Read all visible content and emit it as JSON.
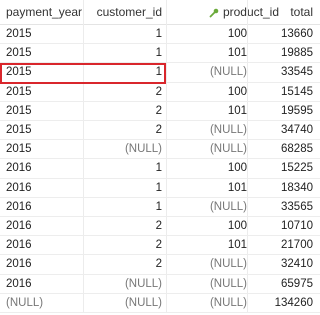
{
  "columns": {
    "payment_year": "payment_year",
    "customer_id": "customer_id",
    "product_id": "product_id",
    "total": "total"
  },
  "key_icon_color": "#6aaa3a",
  "selection_color": "#d9262c",
  "rows": [
    [
      "2015",
      "1",
      "100",
      "13660"
    ],
    [
      "2015",
      "1",
      "101",
      "19885"
    ],
    [
      "2015",
      "1",
      "(NULL)",
      "33545"
    ],
    [
      "2015",
      "2",
      "100",
      "15145"
    ],
    [
      "2015",
      "2",
      "101",
      "19595"
    ],
    [
      "2015",
      "2",
      "(NULL)",
      "34740"
    ],
    [
      "2015",
      "(NULL)",
      "(NULL)",
      "68285"
    ],
    [
      "2016",
      "1",
      "100",
      "15225"
    ],
    [
      "2016",
      "1",
      "101",
      "18340"
    ],
    [
      "2016",
      "1",
      "(NULL)",
      "33565"
    ],
    [
      "2016",
      "2",
      "100",
      "10710"
    ],
    [
      "2016",
      "2",
      "101",
      "21700"
    ],
    [
      "2016",
      "2",
      "(NULL)",
      "32410"
    ],
    [
      "2016",
      "(NULL)",
      "(NULL)",
      "65975"
    ],
    [
      "(NULL)",
      "(NULL)",
      "(NULL)",
      "134260"
    ]
  ],
  "selected_row_index": 2
}
